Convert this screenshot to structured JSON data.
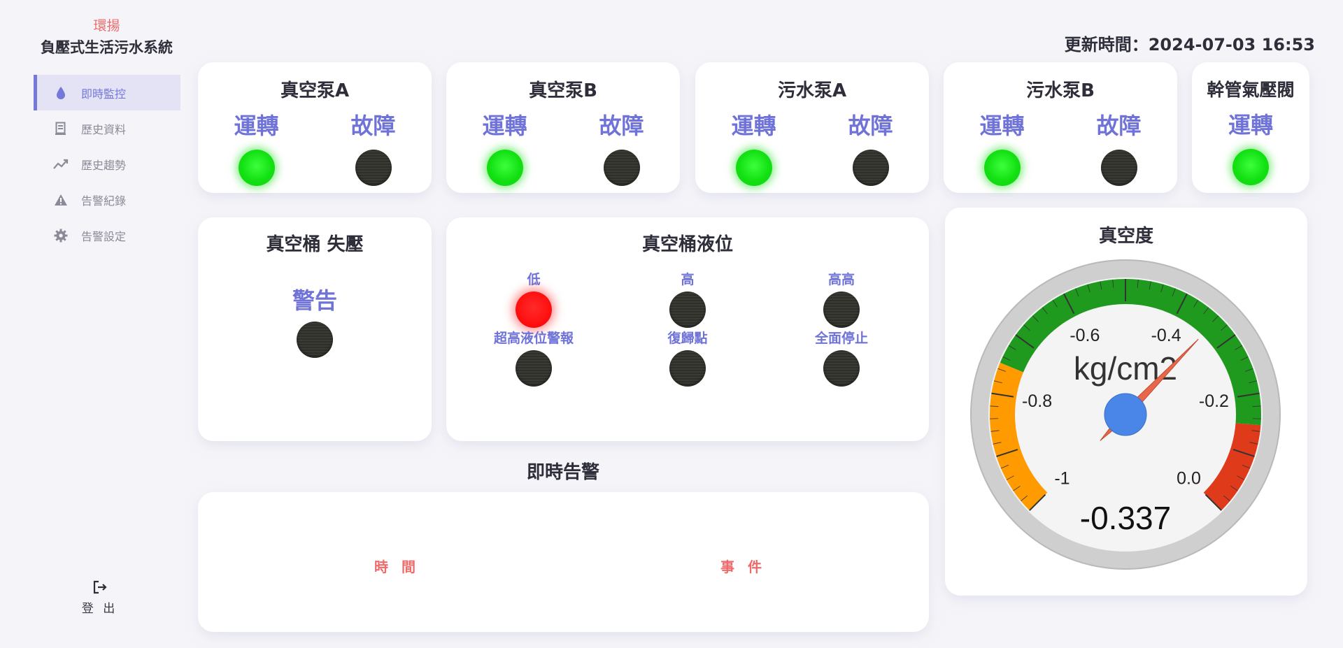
{
  "brand": {
    "top": "環揚",
    "name": "負壓式生活污水系統"
  },
  "header": {
    "update_label": "更新時間：",
    "update_time": "2024-07-03 16:53"
  },
  "sidebar": {
    "items": [
      {
        "label": "即時監控",
        "icon": "droplet-icon",
        "active": true
      },
      {
        "label": "歷史資料",
        "icon": "document-icon",
        "active": false
      },
      {
        "label": "歷史趨勢",
        "icon": "trend-chart-icon",
        "active": false
      },
      {
        "label": "告警紀錄",
        "icon": "warning-triangle-icon",
        "active": false
      },
      {
        "label": "告警設定",
        "icon": "gear-icon",
        "active": false
      }
    ],
    "logout_label": "登 出"
  },
  "pumps": [
    {
      "title": "真空泵A",
      "run_label": "運轉",
      "run_on": true,
      "fault_label": "故障",
      "fault_on": false
    },
    {
      "title": "真空泵B",
      "run_label": "運轉",
      "run_on": true,
      "fault_label": "故障",
      "fault_on": false
    },
    {
      "title": "污水泵A",
      "run_label": "運轉",
      "run_on": true,
      "fault_label": "故障",
      "fault_on": false
    },
    {
      "title": "污水泵B",
      "run_label": "運轉",
      "run_on": true,
      "fault_label": "故障",
      "fault_on": false
    }
  ],
  "valve": {
    "title": "幹管氣壓閥",
    "run_label": "運轉",
    "run_on": true
  },
  "tank_pressure": {
    "title": "真空桶 失壓",
    "warn_label": "警告",
    "warn_on": false
  },
  "tank_level": {
    "title": "真空桶液位",
    "row1": [
      {
        "label": "低",
        "on": true
      },
      {
        "label": "高",
        "on": false
      },
      {
        "label": "高高",
        "on": false
      }
    ],
    "row2": [
      {
        "label": "超高液位警報",
        "on": false
      },
      {
        "label": "復歸點",
        "on": false
      },
      {
        "label": "全面停止",
        "on": false
      }
    ]
  },
  "alarms": {
    "title": "即時告警",
    "col_time": "時 間",
    "col_event": "事 件"
  },
  "gauge": {
    "title": "真空度",
    "unit": "kg/cm2",
    "value": -0.337,
    "value_text": "-0.337",
    "min": -1,
    "max": 0,
    "tick_labels": [
      "-1",
      "-0.8",
      "-0.6",
      "-0.4",
      "-0.2",
      "0.0"
    ],
    "bands": [
      {
        "from": -1,
        "to": -0.75,
        "color": "#ff9b00"
      },
      {
        "from": -0.75,
        "to": -0.15,
        "color": "#1f9a1f"
      },
      {
        "from": -0.15,
        "to": 0,
        "color": "#df3a1a"
      }
    ],
    "needle_color": "#e8674a",
    "hub_color": "#4a86e8"
  }
}
